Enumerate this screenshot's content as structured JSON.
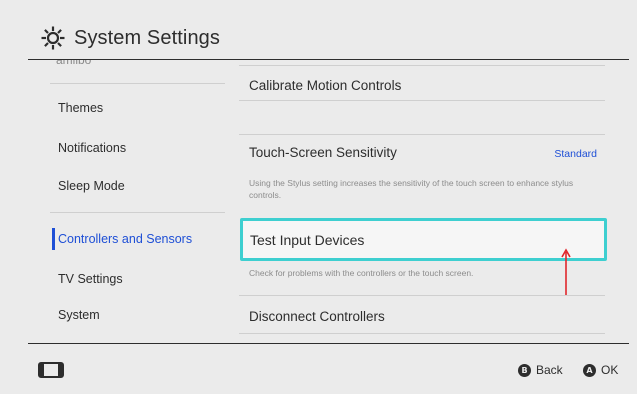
{
  "header": {
    "title": "System Settings",
    "icon": "gear-icon"
  },
  "sidebar": {
    "partial_item": "amiibo",
    "items": [
      {
        "label": "Themes"
      },
      {
        "label": "Notifications"
      },
      {
        "label": "Sleep Mode"
      },
      {
        "label": "Controllers and Sensors",
        "active": true
      },
      {
        "label": "TV Settings"
      },
      {
        "label": "System"
      }
    ]
  },
  "main": {
    "rows": [
      {
        "title": "Calibrate Motion Controls"
      },
      {
        "title": "Touch-Screen Sensitivity",
        "value": "Standard",
        "description": "Using the Stylus setting increases the sensitivity of the touch screen to enhance stylus controls."
      },
      {
        "title": "Test Input Devices",
        "selected": true,
        "description": "Check for problems with the controllers or the touch screen."
      },
      {
        "title": "Disconnect Controllers"
      }
    ]
  },
  "footer": {
    "console_icon": "console-icon",
    "back_button": {
      "glyph": "B",
      "label": "Back"
    },
    "ok_button": {
      "glyph": "A",
      "label": "OK"
    }
  },
  "colors": {
    "background": "#ebebeb",
    "accent_blue": "#1e4fd6",
    "selection_cyan": "#3ecfd0",
    "annotation_red": "#e0262b",
    "text": "#2d2d2d"
  }
}
